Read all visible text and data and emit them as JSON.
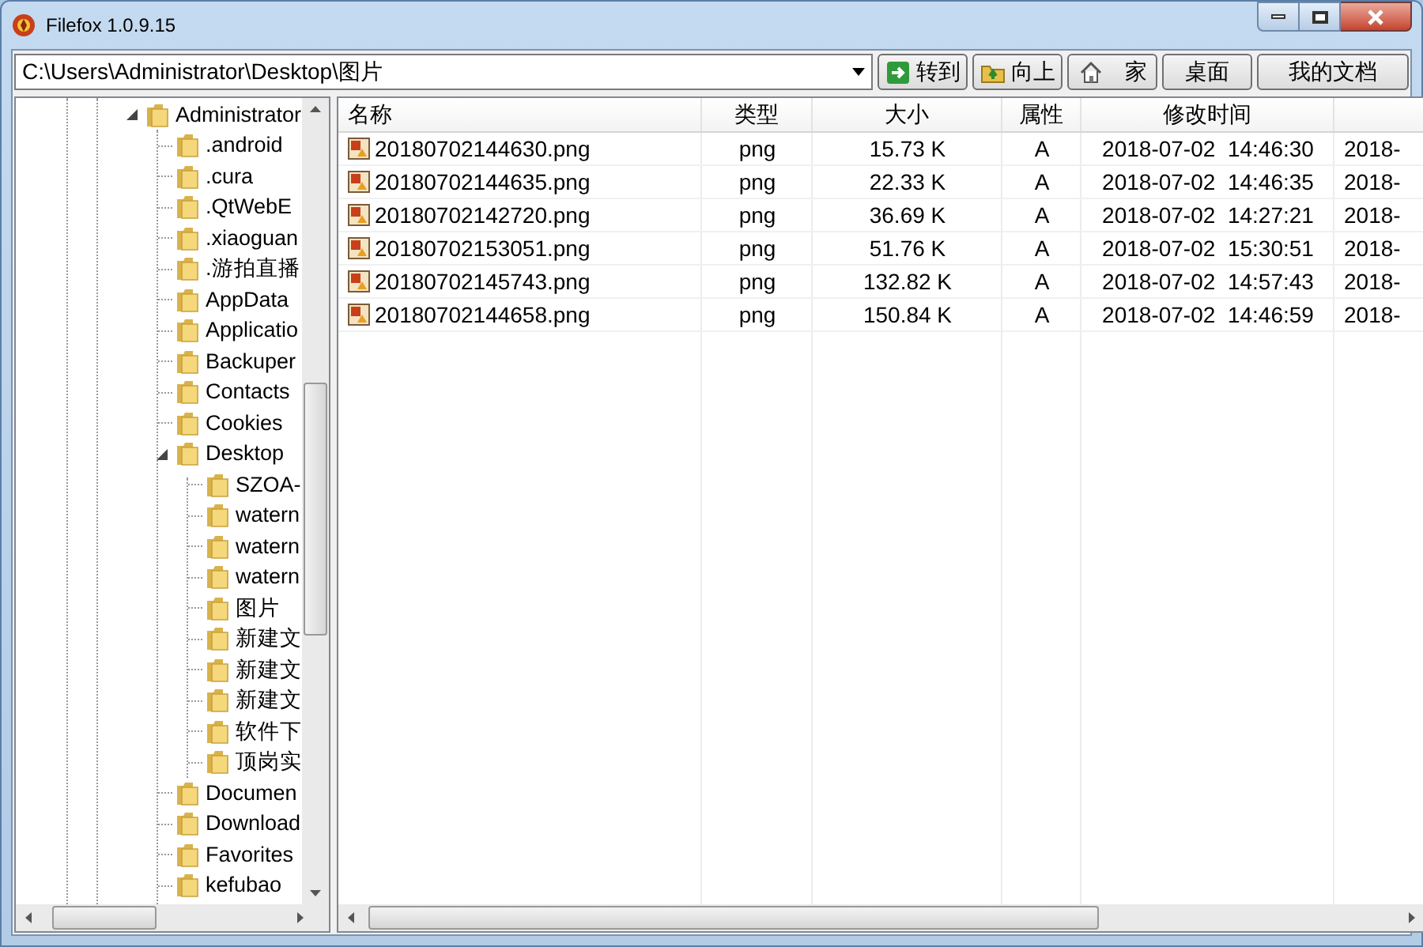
{
  "window": {
    "title": "Filefox 1.0.9.15"
  },
  "path_field": {
    "value": "C:\\Users\\Administrator\\Desktop\\图片"
  },
  "toolbar_buttons": [
    {
      "label": "转到",
      "kind": "go"
    },
    {
      "label": "向上",
      "kind": "up"
    },
    {
      "label": "家",
      "kind": "home"
    },
    {
      "label": "桌面",
      "kind": "plain"
    },
    {
      "label": "我的文档",
      "kind": "plain"
    }
  ],
  "folder_tree": [
    {
      "label": "Administrator",
      "expanded": true,
      "children": [
        {
          "label": ".android"
        },
        {
          "label": ".cura"
        },
        {
          "label": ".QtWebE"
        },
        {
          "label": ".xiaoguan"
        },
        {
          "label": ".游拍直播"
        },
        {
          "label": "AppData"
        },
        {
          "label": "Applicatio"
        },
        {
          "label": "Backuper"
        },
        {
          "label": "Contacts"
        },
        {
          "label": "Cookies"
        },
        {
          "label": "Desktop",
          "expanded": true,
          "children": [
            {
              "label": "SZOA-"
            },
            {
              "label": "watern"
            },
            {
              "label": "watern"
            },
            {
              "label": "watern"
            },
            {
              "label": "图片"
            },
            {
              "label": "新建文"
            },
            {
              "label": "新建文"
            },
            {
              "label": "新建文"
            },
            {
              "label": "软件下"
            },
            {
              "label": "顶岗实"
            }
          ]
        },
        {
          "label": "Documen"
        },
        {
          "label": "Download"
        },
        {
          "label": "Favorites"
        },
        {
          "label": "kefubao"
        }
      ]
    }
  ],
  "file_table": {
    "columns": [
      "名称",
      "类型",
      "大小",
      "属性",
      "修改时间"
    ],
    "rows": [
      {
        "name": "20180702144630.png",
        "type": "png",
        "size": "15.73 K",
        "attributes": "A",
        "modified": "2018-07-02  14:46:30",
        "column_6": "2018-"
      },
      {
        "name": "20180702144635.png",
        "type": "png",
        "size": "22.33 K",
        "attributes": "A",
        "modified": "2018-07-02  14:46:35",
        "column_6": "2018-"
      },
      {
        "name": "20180702142720.png",
        "type": "png",
        "size": "36.69 K",
        "attributes": "A",
        "modified": "2018-07-02  14:27:21",
        "column_6": "2018-"
      },
      {
        "name": "20180702153051.png",
        "type": "png",
        "size": "51.76 K",
        "attributes": "A",
        "modified": "2018-07-02  15:30:51",
        "column_6": "2018-"
      },
      {
        "name": "20180702145743.png",
        "type": "png",
        "size": "132.82 K",
        "attributes": "A",
        "modified": "2018-07-02  14:57:43",
        "column_6": "2018-"
      },
      {
        "name": "20180702144658.png",
        "type": "png",
        "size": "150.84 K",
        "attributes": "A",
        "modified": "2018-07-02  14:46:59",
        "column_6": "2018-"
      }
    ]
  }
}
